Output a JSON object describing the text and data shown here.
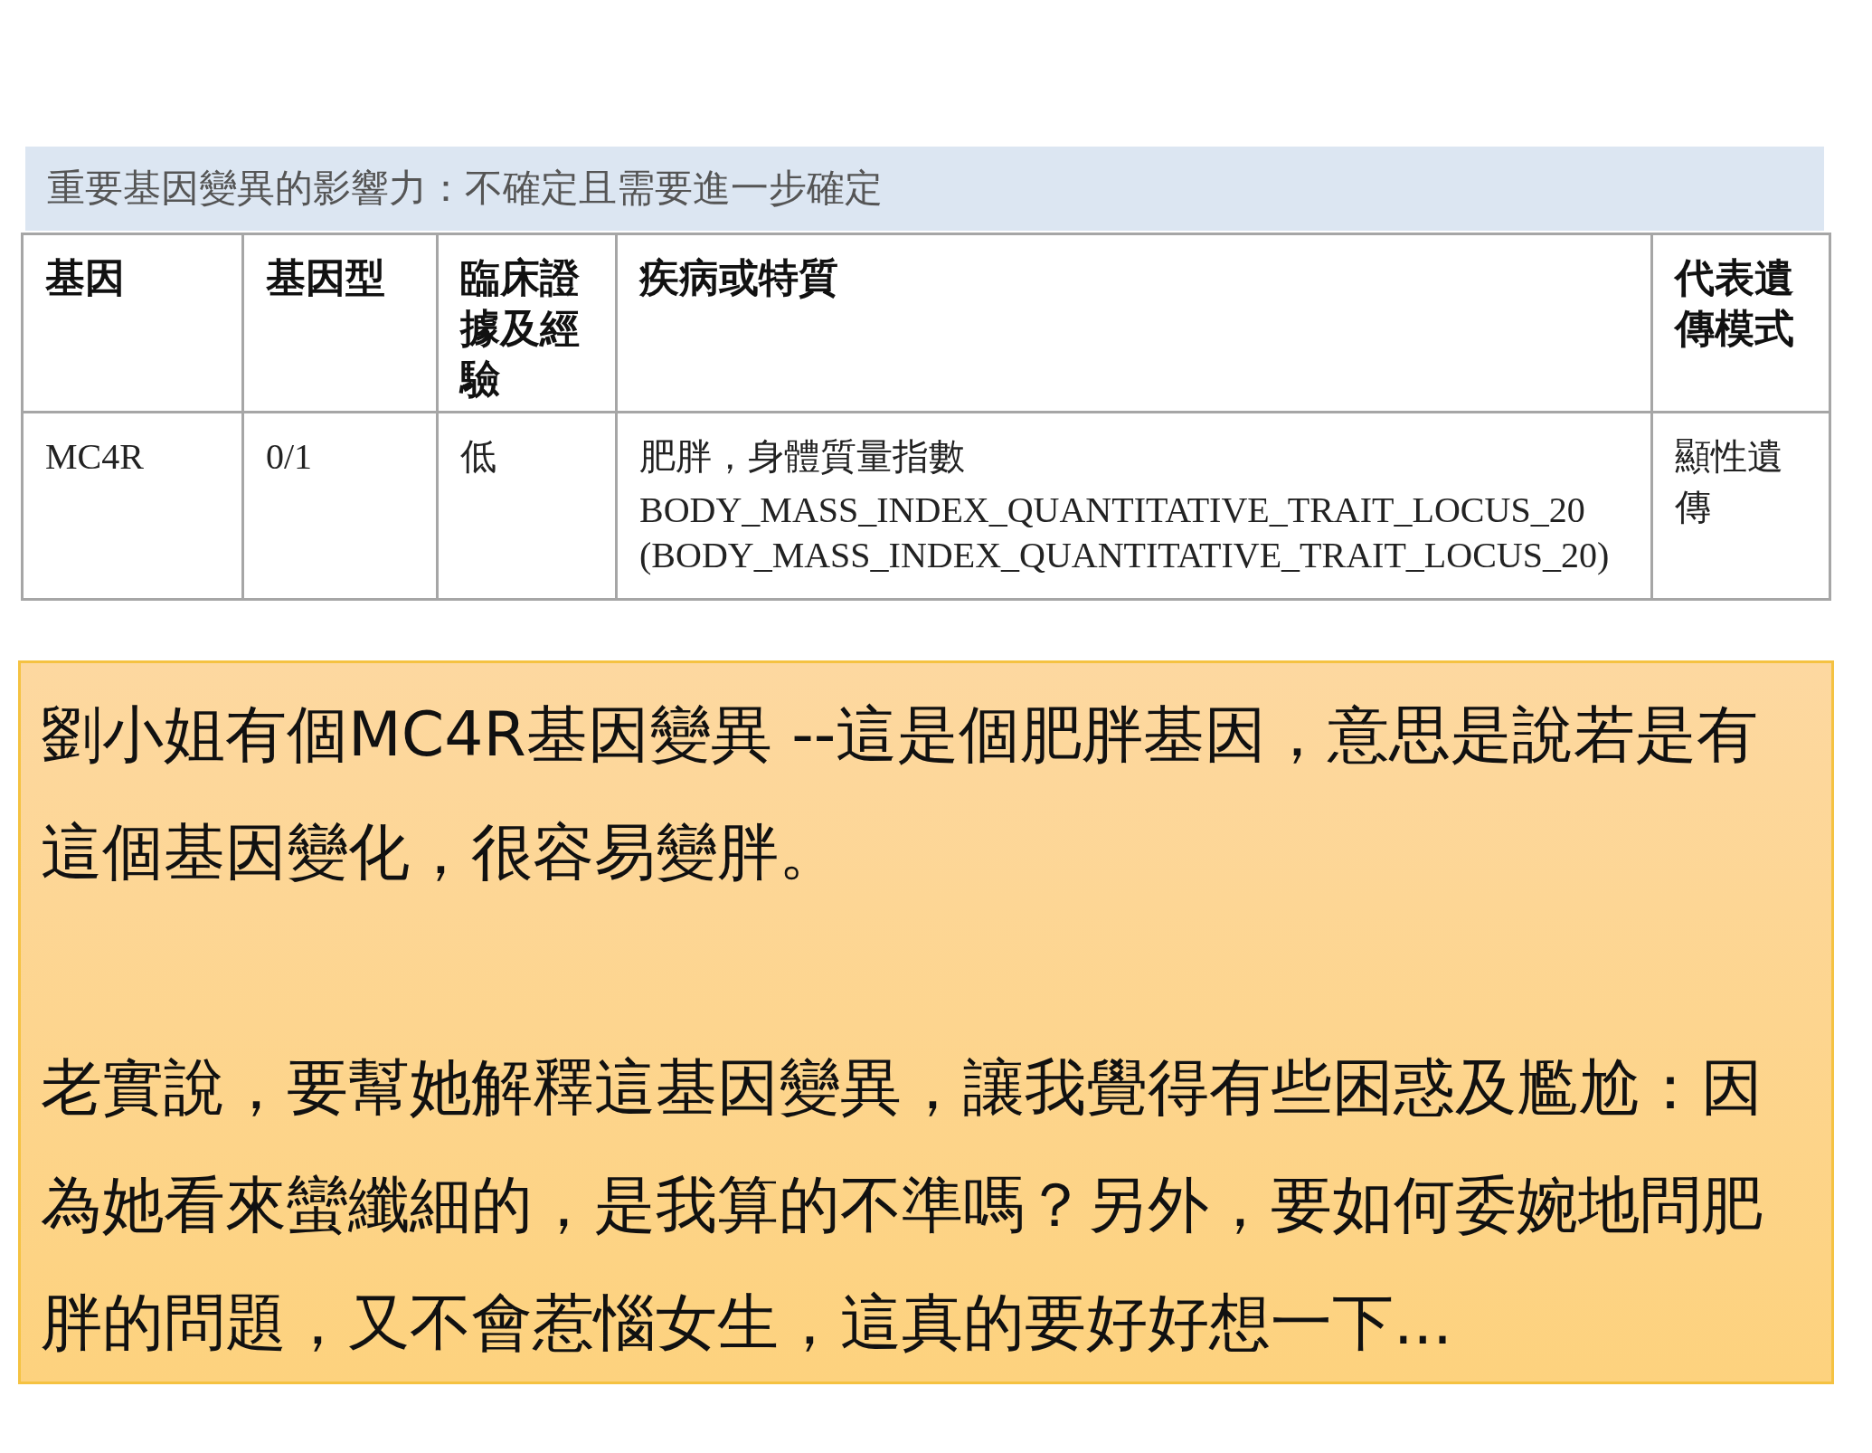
{
  "section_title": "重要基因變異的影響力：不確定且需要進一步確定",
  "table": {
    "columns": [
      "基因",
      "基因型",
      "臨床證據及經驗",
      "疾病或特質",
      "代表遺傳模式"
    ],
    "rows": [
      {
        "gene": "MC4R",
        "genotype": "0/1",
        "evidence": "低",
        "condition": [
          "肥胖，身體質量指數",
          "BODY_MASS_INDEX_QUANTITATIVE_TRAIT_LOCUS_20 (BODY_MASS_INDEX_QUANTITATIVE_TRAIT_LOCUS_20)"
        ],
        "inheritance": "顯性遺傳"
      }
    ]
  },
  "note": {
    "paragraphs": [
      "劉小姐有個MC4R基因變異 --這是個肥胖基因，意思是說若是有這個基因變化，很容易變胖。",
      "老實說，要幫她解釋這基因變異，讓我覺得有些困惑及尷尬：因為她看來蠻纖細的，是我算的不準嗎？另外，要如何委婉地問肥胖的問題，又不會惹惱女生，這真的要好好想一下..."
    ]
  }
}
